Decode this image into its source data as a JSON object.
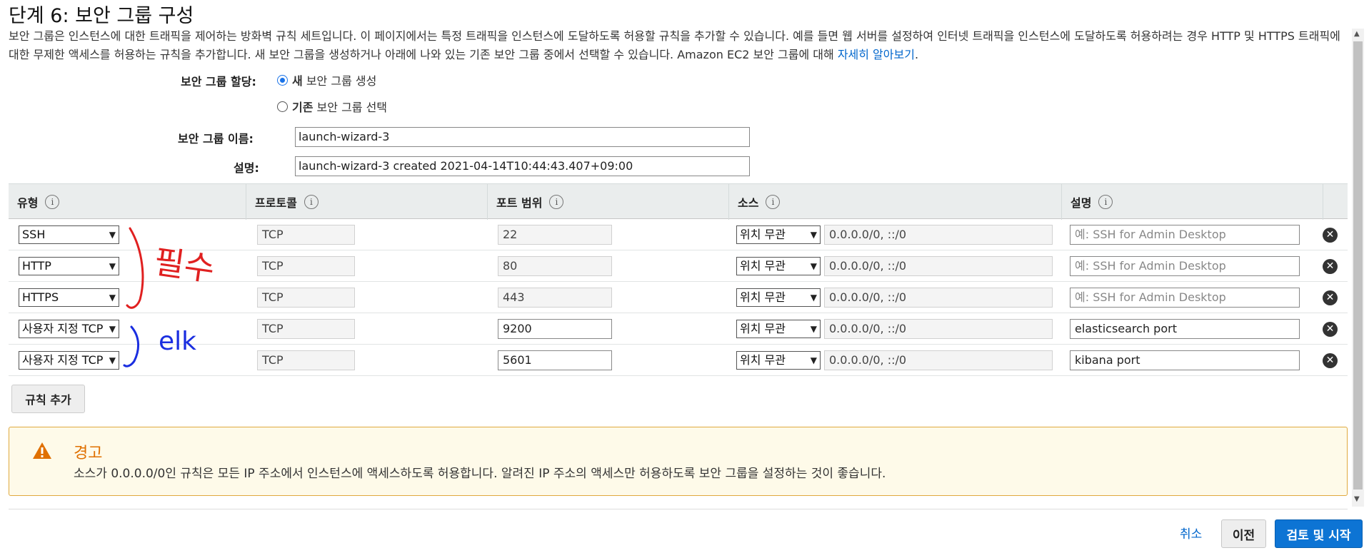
{
  "page": {
    "title": "단계 6: 보안 그룹 구성",
    "intro": "보안 그룹은 인스턴스에 대한 트래픽을 제어하는 방화벽 규칙 세트입니다. 이 페이지에서는 특정 트래픽을 인스턴스에 도달하도록 허용할 규칙을 추가할 수 있습니다. 예를 들면 웹 서버를 설정하여 인터넷 트래픽을 인스턴스에 도달하도록 허용하려는 경우 HTTP 및 HTTPS 트래픽에 대한 무제한 액세스를 허용하는 규칙을 추가합니다. 새 보안 그룹을 생성하거나 아래에 나와 있는 기존 보안 그룹 중에서 선택할 수 있습니다. Amazon EC2 보안 그룹에 대해 ",
    "learn_more": "자세히 알아보기",
    "learn_more_suffix": "."
  },
  "assignment": {
    "label": "보안 그룹 할당:",
    "option_new_bold": "새",
    "option_new_rest": " 보안 그룹 생성",
    "option_existing_bold": "기존",
    "option_existing_rest": " 보안 그룹 선택",
    "selected": "new"
  },
  "group_name": {
    "label": "보안 그룹 이름:",
    "value": "launch-wizard-3"
  },
  "description": {
    "label": "설명:",
    "value": "launch-wizard-3 created 2021-04-14T10:44:43.407+09:00"
  },
  "table": {
    "headers": {
      "type": "유형",
      "protocol": "프로토콜",
      "port": "포트 범위",
      "source": "소스",
      "desc": "설명"
    },
    "info_glyph": "i",
    "rows": [
      {
        "type": "SSH",
        "protocol": "TCP",
        "port": "22",
        "port_editable": false,
        "source_mode": "위치 무관",
        "source_cidr": "0.0.0.0/0, ::/0",
        "desc": "",
        "desc_placeholder": "예: SSH for Admin Desktop"
      },
      {
        "type": "HTTP",
        "protocol": "TCP",
        "port": "80",
        "port_editable": false,
        "source_mode": "위치 무관",
        "source_cidr": "0.0.0.0/0, ::/0",
        "desc": "",
        "desc_placeholder": "예: SSH for Admin Desktop"
      },
      {
        "type": "HTTPS",
        "protocol": "TCP",
        "port": "443",
        "port_editable": false,
        "source_mode": "위치 무관",
        "source_cidr": "0.0.0.0/0, ::/0",
        "desc": "",
        "desc_placeholder": "예: SSH for Admin Desktop"
      },
      {
        "type": "사용자 지정 TCP",
        "protocol": "TCP",
        "port": "9200",
        "port_editable": true,
        "source_mode": "위치 무관",
        "source_cidr": "0.0.0.0/0, ::/0",
        "desc": "elasticsearch port",
        "desc_placeholder": ""
      },
      {
        "type": "사용자 지정 TCP",
        "protocol": "TCP",
        "port": "5601",
        "port_editable": true,
        "source_mode": "위치 무관",
        "source_cidr": "0.0.0.0/0, ::/0",
        "desc": "kibana port",
        "desc_placeholder": ""
      }
    ],
    "delete_glyph": "✕"
  },
  "add_rule": "규칙 추가",
  "warning": {
    "icon": "warning-triangle-icon",
    "title": "경고",
    "text": "소스가 0.0.0.0/0인 규칙은 모든 IP 주소에서 인스턴스에 액세스하도록 허용합니다. 알려진 IP 주소의 액세스만 허용하도록 보안 그룹을 설정하는 것이 좋습니다."
  },
  "annotations": {
    "required": "필수",
    "elk": "elk"
  },
  "footer": {
    "cancel": "취소",
    "previous": "이전",
    "review": "검토 및 시작"
  },
  "colors": {
    "accent": "#0d74d4",
    "warning_border": "#e0a93e",
    "warning_title": "#e07000",
    "annot_red": "#e02020",
    "annot_blue": "#1a2ee0"
  }
}
